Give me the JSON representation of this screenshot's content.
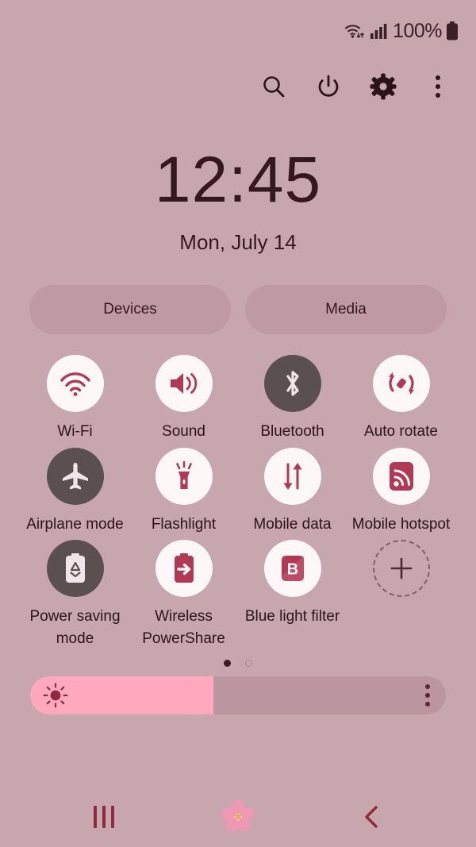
{
  "status_bar": {
    "wifi_icon": "wifi-data-icon",
    "signal_icon": "cellular-signal-icon",
    "battery_percent": "100%",
    "battery_icon": "battery-full-icon"
  },
  "action_bar": {
    "search_icon": "search-icon",
    "power_icon": "power-icon",
    "settings_icon": "gear-icon",
    "more_icon": "kebab-menu-icon"
  },
  "clock": {
    "time": "12:45",
    "date": "Mon, July 14"
  },
  "pills": [
    {
      "label": "Devices",
      "name": "devices-button"
    },
    {
      "label": "Media",
      "name": "media-button"
    }
  ],
  "toggles": [
    {
      "label": "Wi-Fi",
      "icon": "wifi-icon",
      "state": "on"
    },
    {
      "label": "Sound",
      "icon": "sound-icon",
      "state": "on"
    },
    {
      "label": "Bluetooth",
      "icon": "bluetooth-icon",
      "state": "off"
    },
    {
      "label": "Auto rotate",
      "icon": "auto-rotate-icon",
      "state": "on"
    },
    {
      "label": "Airplane mode",
      "icon": "airplane-icon",
      "state": "off"
    },
    {
      "label": "Flashlight",
      "icon": "flashlight-icon",
      "state": "on"
    },
    {
      "label": "Mobile data",
      "icon": "mobile-data-icon",
      "state": "on"
    },
    {
      "label": "Mobile hotspot",
      "icon": "hotspot-icon",
      "state": "on"
    },
    {
      "label": "Power saving mode",
      "icon": "power-saving-icon",
      "state": "off"
    },
    {
      "label": "Wireless PowerShare",
      "icon": "wireless-powershare-icon",
      "state": "on"
    },
    {
      "label": "Blue light filter",
      "icon": "blue-light-filter-icon",
      "state": "on"
    },
    {
      "label": "",
      "icon": "add-icon",
      "state": "add"
    }
  ],
  "pagination": {
    "total": 2,
    "active_index": 0
  },
  "brightness": {
    "value_percent": 44,
    "sun_icon": "brightness-sun-icon",
    "more_icon": "kebab-menu-icon"
  },
  "nav_bar": {
    "recents_icon": "recents-icon",
    "home_icon": "cherry-blossom-home-icon",
    "back_icon": "back-chevron-icon"
  },
  "colors": {
    "background": "#c8a6ae",
    "accent": "#b03a55",
    "tile_on_bg": "#fdf7f7",
    "tile_off_bg": "#5a5050",
    "pill_bg": "#bf9aa3",
    "slider_fill": "#ffa8be",
    "slider_track": "#bb96a0",
    "text": "#2b1418"
  }
}
